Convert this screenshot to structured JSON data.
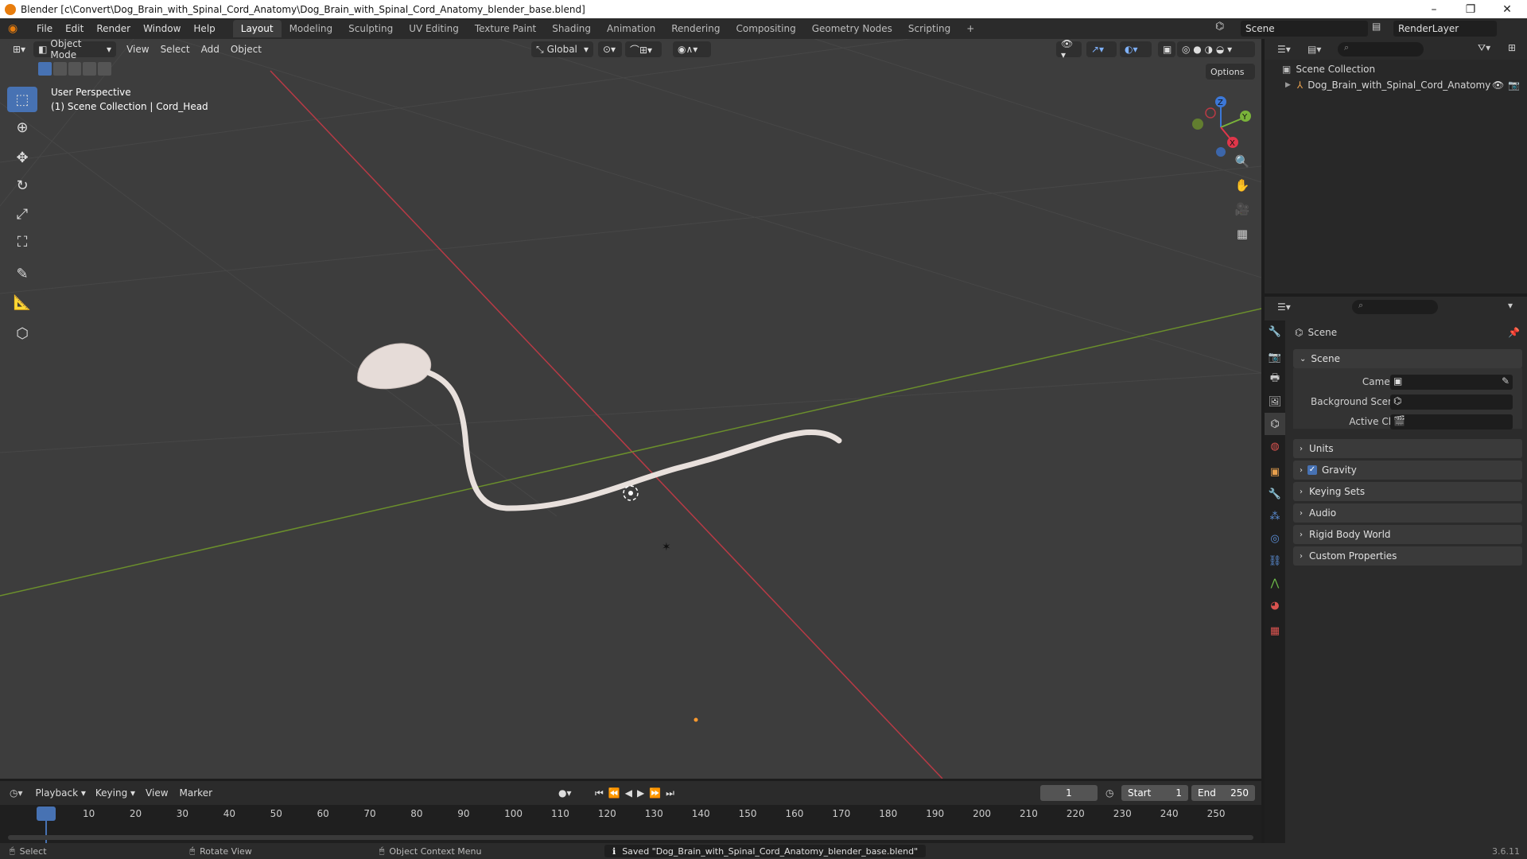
{
  "window": {
    "title": "Blender [c\\Convert\\Dog_Brain_with_Spinal_Cord_Anatomy\\Dog_Brain_with_Spinal_Cord_Anatomy_blender_base.blend]",
    "minimize": "–",
    "maximize": "❐",
    "close": "✕"
  },
  "menubar": {
    "items": [
      "File",
      "Edit",
      "Render",
      "Window",
      "Help"
    ]
  },
  "workspaces": [
    "Layout",
    "Modeling",
    "Sculpting",
    "UV Editing",
    "Texture Paint",
    "Shading",
    "Animation",
    "Rendering",
    "Compositing",
    "Geometry Nodes",
    "Scripting"
  ],
  "add_workspace": "+",
  "scene_selector": "Scene",
  "renderlayer_selector": "RenderLayer",
  "viewport": {
    "mode": "Object Mode",
    "menus": [
      "View",
      "Select",
      "Add",
      "Object"
    ],
    "orientation": "Global",
    "options": "Options",
    "overlay_line1": "User Perspective",
    "overlay_line2": "(1) Scene Collection | Cord_Head",
    "gizmo": {
      "x": "X",
      "y": "Y",
      "z": "Z"
    }
  },
  "outliner": {
    "root": "Scene Collection",
    "child": "Dog_Brain_with_Spinal_Cord_Anatomy"
  },
  "properties": {
    "context": "Scene",
    "panel": "Scene",
    "camera_label": "Camera",
    "background_label": "Background Scene",
    "clip_label": "Active Clip",
    "sections": [
      "Units",
      "Gravity",
      "Keying Sets",
      "Audio",
      "Rigid Body World",
      "Custom Properties"
    ],
    "gravity_checked": true
  },
  "timeline": {
    "menus": [
      "Playback",
      "Keying",
      "View",
      "Marker"
    ],
    "current_frame": "1",
    "start_label": "Start",
    "start_value": "1",
    "end_label": "End",
    "end_value": "250",
    "ticks": [
      "1",
      "10",
      "20",
      "30",
      "40",
      "50",
      "60",
      "70",
      "80",
      "90",
      "100",
      "110",
      "120",
      "130",
      "140",
      "150",
      "160",
      "170",
      "180",
      "190",
      "200",
      "210",
      "220",
      "230",
      "240",
      "250"
    ]
  },
  "statusbar": {
    "select": "Select",
    "rotate": "Rotate View",
    "context_menu": "Object Context Menu",
    "message": "Saved \"Dog_Brain_with_Spinal_Cord_Anatomy_blender_base.blend\"",
    "version": "3.6.11"
  }
}
